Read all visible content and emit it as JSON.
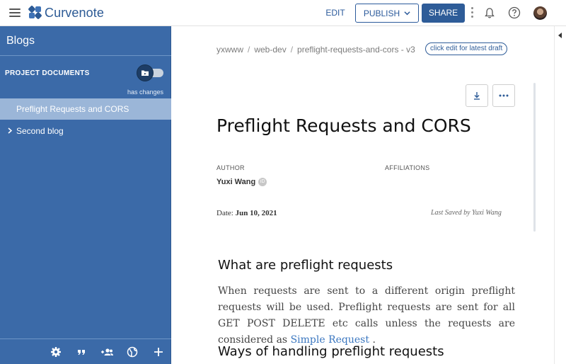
{
  "app": {
    "name": "Curvenote",
    "brand_color": "#2c5a95"
  },
  "topbar": {
    "edit_label": "EDIT",
    "publish_label": "PUBLISH",
    "share_label": "SHARE"
  },
  "sidebar": {
    "title": "Blogs",
    "section_title": "PROJECT DOCUMENTS",
    "status_text": "has changes",
    "items": [
      {
        "label": "Preflight Requests and CORS",
        "active": true
      },
      {
        "label": "Second blog",
        "active": false
      }
    ],
    "background_color": "#3b6aa8"
  },
  "breadcrumb": {
    "parts": [
      "yxwww",
      "web-dev",
      "preflight-requests-and-cors - v3"
    ],
    "separator": "/",
    "draft_link": "click edit for latest draft"
  },
  "document": {
    "title": "Preflight Requests and CORS",
    "author_label": "AUTHOR",
    "affiliations_label": "AFFILIATIONS",
    "author_name": "Yuxi Wang",
    "orcid_badge": "iD",
    "date_label": "Date:",
    "date_value": "Jun 10, 2021",
    "last_saved": "Last Saved by Yuxi Wang",
    "sections": [
      {
        "heading": "What are preflight requests",
        "paragraph_text": "When requests are sent to a different origin preflight requests will be used. Preflight requests are sent for all GET POST DELETE etc calls unless the requests are considered as ",
        "link_text": "Simple Request",
        "paragraph_end": " ."
      },
      {
        "heading": "Ways of handling preflight requests"
      }
    ]
  }
}
